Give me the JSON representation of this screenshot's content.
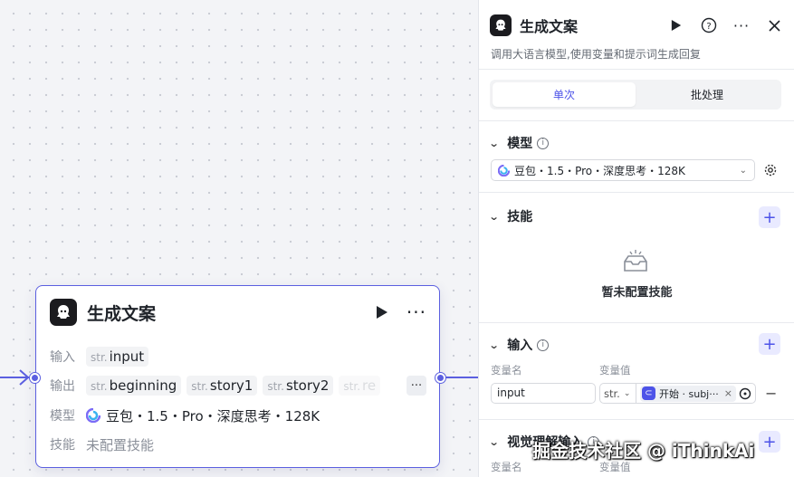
{
  "node": {
    "title": "生成文案",
    "rows": {
      "input_label": "输入",
      "output_label": "输出",
      "model_label": "模型",
      "skill_label": "技能"
    },
    "inputs": [
      {
        "type": "str.",
        "name": "input"
      }
    ],
    "outputs": [
      {
        "type": "str.",
        "name": "beginning"
      },
      {
        "type": "str.",
        "name": "story1"
      },
      {
        "type": "str.",
        "name": "story2"
      },
      {
        "type": "str.",
        "name": "re"
      }
    ],
    "model": "豆包・1.5・Pro・深度思考・128K",
    "skills": "未配置技能"
  },
  "panel": {
    "title": "生成文案",
    "description": "调用大语言模型,使用变量和提示词生成回复",
    "tabs": [
      "单次",
      "批处理"
    ],
    "active_tab": "单次",
    "model_section": {
      "title": "模型",
      "selected": "豆包・1.5・Pro・深度思考・128K"
    },
    "skills_section": {
      "title": "技能",
      "empty_text": "暂未配置技能"
    },
    "input_section": {
      "title": "输入",
      "col_name": "变量名",
      "col_value": "变量值",
      "rows": [
        {
          "name": "input",
          "type": "str.",
          "ref": "开始 · subj···"
        }
      ]
    },
    "vision_section": {
      "title": "视觉理解输入",
      "col_name": "变量名",
      "col_value": "变量值"
    }
  },
  "watermark": "掘金技术社区 @ iThinkAi",
  "colors": {
    "accent": "#4d53e8",
    "node_border": "#5b5fe0"
  }
}
